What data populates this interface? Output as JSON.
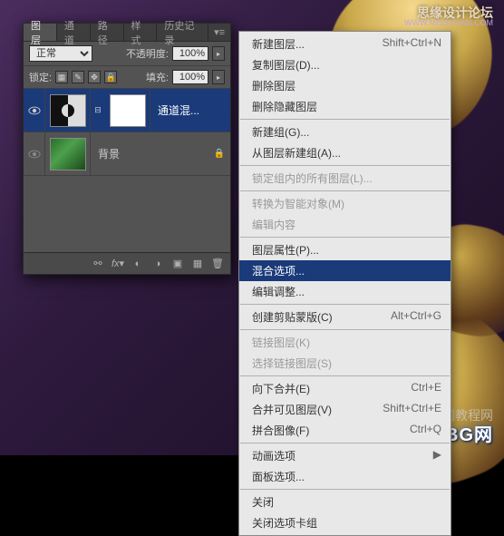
{
  "watermarks": {
    "top_text": "思缘设计论坛",
    "top_url": "WWW.MISSYUAN.COM",
    "br_site": "JUiBG网",
    "br_cn": "中国教程网"
  },
  "panel": {
    "tabs": [
      "图层",
      "通道",
      "路径",
      "样式",
      "历史记录"
    ],
    "active_tab_index": 0,
    "blend_mode": "正常",
    "opacity_label": "不透明度:",
    "opacity_value": "100%",
    "lock_label": "锁定:",
    "fill_label": "填充:",
    "fill_value": "100%"
  },
  "layers": [
    {
      "name": "通道混...",
      "selected": true,
      "locked": false,
      "type": "adjustment"
    },
    {
      "name": "背景",
      "selected": false,
      "locked": true,
      "type": "image"
    }
  ],
  "footer_icons": [
    "link",
    "fx",
    "mask",
    "adjustment",
    "group",
    "new",
    "trash"
  ],
  "menu": [
    {
      "label": "新建图层...",
      "shortcut": "Shift+Ctrl+N",
      "disabled": false
    },
    {
      "label": "复制图层(D)...",
      "disabled": false
    },
    {
      "label": "删除图层",
      "disabled": false
    },
    {
      "label": "删除隐藏图层",
      "disabled": false
    },
    {
      "sep": true
    },
    {
      "label": "新建组(G)...",
      "disabled": false
    },
    {
      "label": "从图层新建组(A)...",
      "disabled": false
    },
    {
      "sep": true
    },
    {
      "label": "锁定组内的所有图层(L)...",
      "disabled": true
    },
    {
      "sep": true
    },
    {
      "label": "转换为智能对象(M)",
      "disabled": true
    },
    {
      "label": "编辑内容",
      "disabled": true
    },
    {
      "sep": true
    },
    {
      "label": "图层属性(P)...",
      "disabled": false
    },
    {
      "label": "混合选项...",
      "disabled": false,
      "highlighted": true
    },
    {
      "label": "编辑调整...",
      "disabled": false
    },
    {
      "sep": true
    },
    {
      "label": "创建剪贴蒙版(C)",
      "shortcut": "Alt+Ctrl+G",
      "disabled": false
    },
    {
      "sep": true
    },
    {
      "label": "链接图层(K)",
      "disabled": true
    },
    {
      "label": "选择链接图层(S)",
      "disabled": true
    },
    {
      "sep": true
    },
    {
      "label": "向下合并(E)",
      "shortcut": "Ctrl+E",
      "disabled": false
    },
    {
      "label": "合并可见图层(V)",
      "shortcut": "Shift+Ctrl+E",
      "disabled": false
    },
    {
      "label": "拼合图像(F)",
      "shortcut": "Ctrl+Q",
      "disabled": false
    },
    {
      "sep": true
    },
    {
      "label": "动画选项",
      "disabled": false,
      "submenu": true
    },
    {
      "label": "面板选项...",
      "disabled": false
    },
    {
      "sep": true
    },
    {
      "label": "关闭",
      "disabled": false
    },
    {
      "label": "关闭选项卡组",
      "disabled": false
    }
  ]
}
